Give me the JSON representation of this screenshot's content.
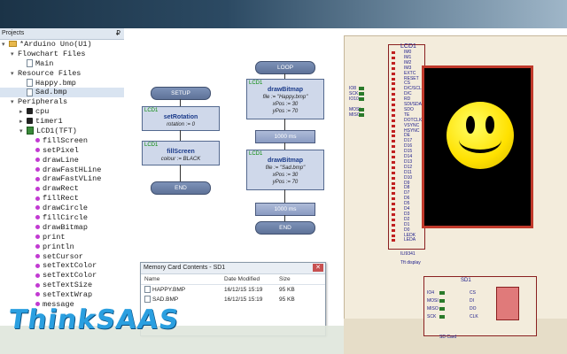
{
  "projects": {
    "title": "Projects",
    "pin": "₽",
    "items": [
      {
        "text": "*Arduino Uno(U1)",
        "icon": "folder-icon",
        "indent": 0,
        "twist": "▾"
      },
      {
        "text": "Flowchart Files",
        "icon": "",
        "indent": 1,
        "twist": "▾"
      },
      {
        "text": "Main",
        "icon": "file-icon",
        "indent": 2,
        "twist": ""
      },
      {
        "text": "Resource Files",
        "icon": "",
        "indent": 1,
        "twist": "▾"
      },
      {
        "text": "Happy.bmp",
        "icon": "file-icon",
        "indent": 2,
        "twist": ""
      },
      {
        "text": "Sad.bmp",
        "icon": "file-icon",
        "indent": 2,
        "twist": "",
        "selected": true
      },
      {
        "text": "Peripherals",
        "icon": "",
        "indent": 1,
        "twist": "▾"
      },
      {
        "text": "cpu",
        "icon": "chip-icon",
        "indent": 2,
        "twist": "▸"
      },
      {
        "text": "timer1",
        "icon": "chip-icon",
        "indent": 2,
        "twist": "▸"
      },
      {
        "text": "LCD1(TFT)",
        "icon": "lcd-icon",
        "indent": 2,
        "twist": "▾"
      },
      {
        "text": "fillScreen",
        "icon": "method-icon",
        "indent": 3,
        "twist": ""
      },
      {
        "text": "setPixel",
        "icon": "method-icon",
        "indent": 3,
        "twist": ""
      },
      {
        "text": "drawLine",
        "icon": "method-icon",
        "indent": 3,
        "twist": ""
      },
      {
        "text": "drawFastHLine",
        "icon": "method-icon",
        "indent": 3,
        "twist": ""
      },
      {
        "text": "drawFastVLine",
        "icon": "method-icon",
        "indent": 3,
        "twist": ""
      },
      {
        "text": "drawRect",
        "icon": "method-icon",
        "indent": 3,
        "twist": ""
      },
      {
        "text": "fillRect",
        "icon": "method-icon",
        "indent": 3,
        "twist": ""
      },
      {
        "text": "drawCircle",
        "icon": "method-icon",
        "indent": 3,
        "twist": ""
      },
      {
        "text": "fillCircle",
        "icon": "method-icon",
        "indent": 3,
        "twist": ""
      },
      {
        "text": "drawBitmap",
        "icon": "method-icon",
        "indent": 3,
        "twist": ""
      },
      {
        "text": "print",
        "icon": "method-icon",
        "indent": 3,
        "twist": ""
      },
      {
        "text": "println",
        "icon": "method-icon",
        "indent": 3,
        "twist": ""
      },
      {
        "text": "setCursor",
        "icon": "method-icon",
        "indent": 3,
        "twist": ""
      },
      {
        "text": "setTextColor",
        "icon": "method-icon",
        "indent": 3,
        "twist": ""
      },
      {
        "text": "setTextColor",
        "icon": "method-icon",
        "indent": 3,
        "twist": ""
      },
      {
        "text": "setTextSize",
        "icon": "method-icon",
        "indent": 3,
        "twist": ""
      },
      {
        "text": "setTextWrap",
        "icon": "method-icon",
        "indent": 3,
        "twist": ""
      },
      {
        "text": "message",
        "icon": "method-icon",
        "indent": 3,
        "twist": ""
      }
    ]
  },
  "flowchart": {
    "setup": {
      "start": "SETUP",
      "end": "END",
      "blocks": [
        {
          "device": "LCD1",
          "method": "setRotation",
          "params": [
            "rotation := 0"
          ]
        },
        {
          "device": "LCD1",
          "method": "fillScreen",
          "params": [
            "colour := BLACK"
          ]
        }
      ]
    },
    "loop": {
      "start": "LOOP",
      "end": "END",
      "blocks": [
        {
          "device": "LCD1",
          "method": "drawBitmap",
          "params": [
            "file := \"Happy.bmp\"",
            "xPos := 30",
            "yPos := 70"
          ]
        },
        {
          "delay": "1000 ms"
        },
        {
          "device": "LCD1",
          "method": "drawBitmap",
          "params": [
            "file := \"Sad.bmp\"",
            "xPos := 30",
            "yPos := 70"
          ]
        },
        {
          "delay": "1000 ms"
        }
      ]
    }
  },
  "memory_card": {
    "title": "Memory Card Contents - SD1",
    "close": "✕",
    "columns": [
      "Name",
      "Date Modified",
      "Size"
    ],
    "rows": [
      [
        "HAPPY.BMP",
        "16/12/15 15:19",
        "95 KB"
      ],
      [
        "SAD.BMP",
        "16/12/15 15:19",
        "95 KB"
      ]
    ]
  },
  "schematic": {
    "lcd_label": "LCD1",
    "lcd_pins": [
      "IM0",
      "IM1",
      "IM2",
      "IM3",
      "EXTC",
      "RESET",
      "CS",
      "D/C/SCL",
      "D/C",
      "RD",
      "SDI/SDA",
      "SDO",
      "TE",
      "DOTCLK",
      "VSYNC",
      "HSYNC",
      "DE",
      "D17",
      "D16",
      "D15",
      "D14",
      "D13",
      "D12",
      "D11",
      "D10",
      "D9",
      "D8",
      "D7",
      "D6",
      "D5",
      "D4",
      "D3",
      "D2",
      "D1",
      "D0",
      "LEDK",
      "LEDA"
    ],
    "left_labels": [
      "IO8",
      "SCK",
      "IO10",
      "MOSI",
      "MISO"
    ],
    "lcd_footer": "ILI9341",
    "lcd_caption": "Tft display",
    "sd_label": "SD1",
    "sd_left": [
      "IO4",
      "MOSI",
      "MISO",
      "SCK"
    ],
    "sd_pins": [
      "CS",
      "DI",
      "DO",
      "CLK"
    ],
    "sd_caption": "SD Card"
  },
  "watermark": "ThinkSAAS",
  "colors": {
    "lcd_screen": "#000000",
    "smiley": "#ffe100",
    "accent": "#2a9fe0"
  }
}
